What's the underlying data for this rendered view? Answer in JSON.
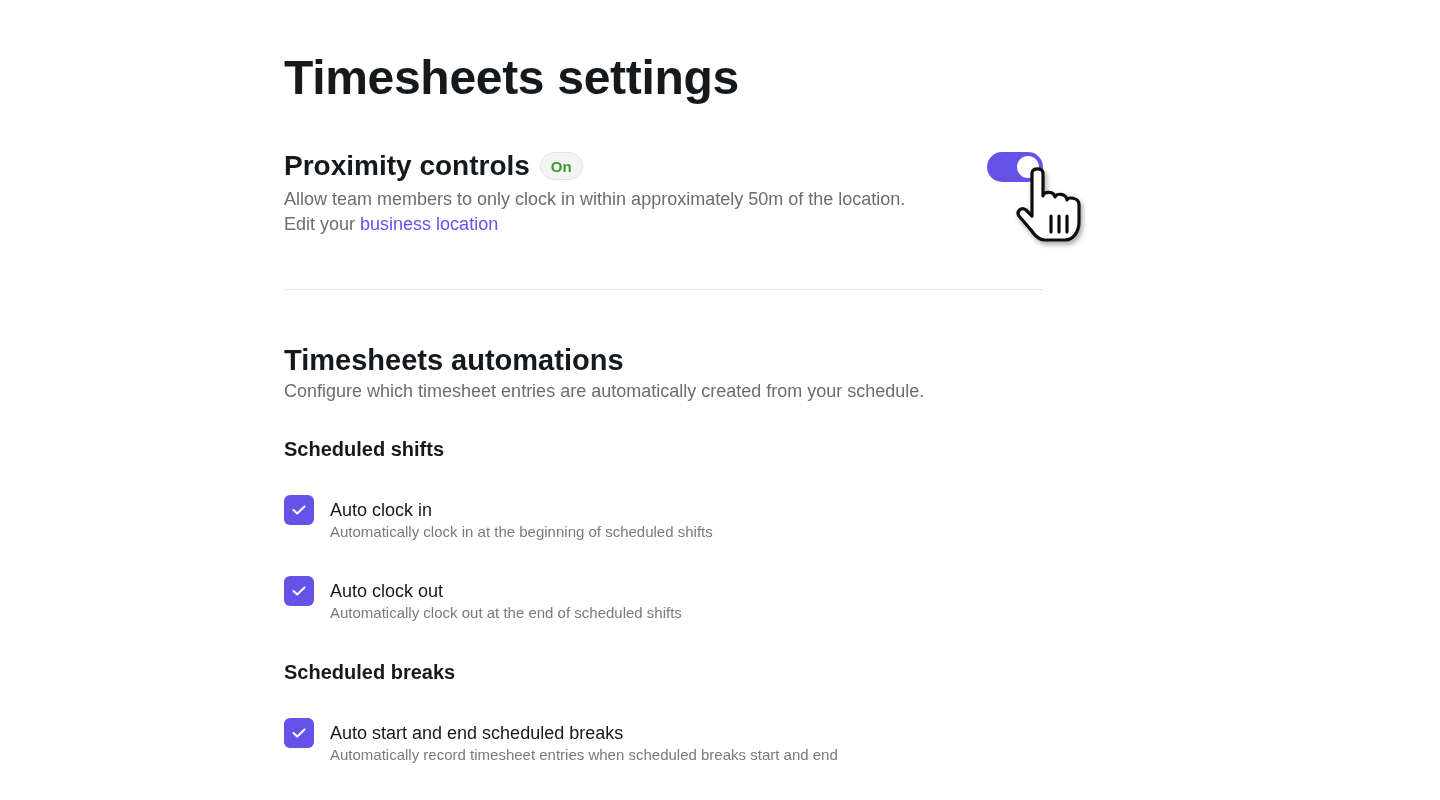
{
  "page": {
    "title": "Timesheets settings"
  },
  "proximity": {
    "title": "Proximity controls",
    "badge": "On",
    "on": true,
    "description": "Allow team members to only clock in within approximately 50m of the location.",
    "link_prefix": "Edit your",
    "link": "business location"
  },
  "automations": {
    "title": "Timesheets automations",
    "description": "Configure which timesheet entries are automatically created from your schedule.",
    "groups": [
      {
        "title": "Scheduled shifts",
        "options": [
          {
            "label": "Auto clock in",
            "description": "Automatically clock in at the beginning of scheduled shifts",
            "checked": true
          },
          {
            "label": "Auto clock out",
            "description": "Automatically clock out at the end of scheduled shifts",
            "checked": true
          }
        ]
      },
      {
        "title": "Scheduled breaks",
        "options": [
          {
            "label": "Auto start and end scheduled breaks",
            "description": "Automatically record timesheet entries when scheduled breaks start and end",
            "checked": true
          }
        ]
      }
    ]
  }
}
